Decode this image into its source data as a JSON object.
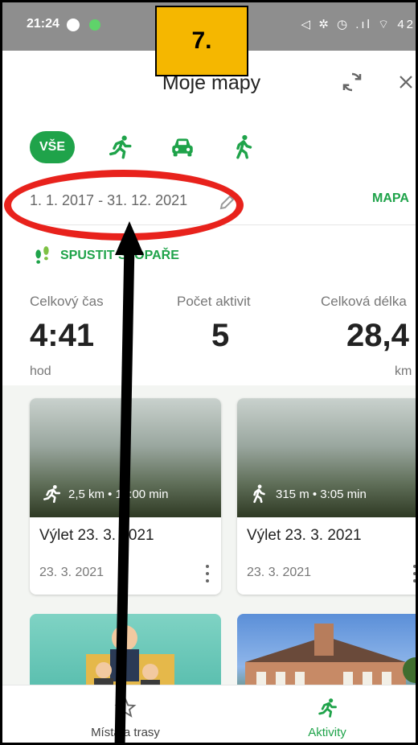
{
  "status_bar": {
    "time": "21:24",
    "right_icons": "◁ ✲ ◷ .ıl ⌔ 42"
  },
  "callout": {
    "step": "7."
  },
  "header": {
    "title": "Moje mapy"
  },
  "filters": {
    "all_label": "VŠE"
  },
  "date_range": {
    "value": "1. 1. 2017 - 31. 12. 2021",
    "map_label": "MAPA"
  },
  "tracker": {
    "label": "SPUSTIT STOPAŘE"
  },
  "stats": [
    {
      "label": "Celkový čas",
      "value": "4:41",
      "unit": "hod"
    },
    {
      "label": "Počet aktivit",
      "value": "5",
      "unit": ""
    },
    {
      "label": "Celková délka",
      "value": "28,4",
      "unit": "km"
    }
  ],
  "cards": [
    {
      "meta": "2,5 km • 18:00 min",
      "title": "Výlet 23. 3. 2021",
      "date": "23. 3. 2021",
      "icon": "run-icon"
    },
    {
      "meta": "315 m • 3:05 min",
      "title": "Výlet 23. 3. 2021",
      "date": "23. 3. 2021",
      "icon": "walk-icon"
    }
  ],
  "bottom_nav": [
    {
      "label": "Místa a trasy",
      "icon": "star-outline-icon",
      "active": false
    },
    {
      "label": "Aktivity",
      "icon": "run-icon",
      "active": true
    }
  ],
  "colors": {
    "accent": "#1fa34a",
    "callout": "#f5b700",
    "highlight": "#e8221c"
  }
}
